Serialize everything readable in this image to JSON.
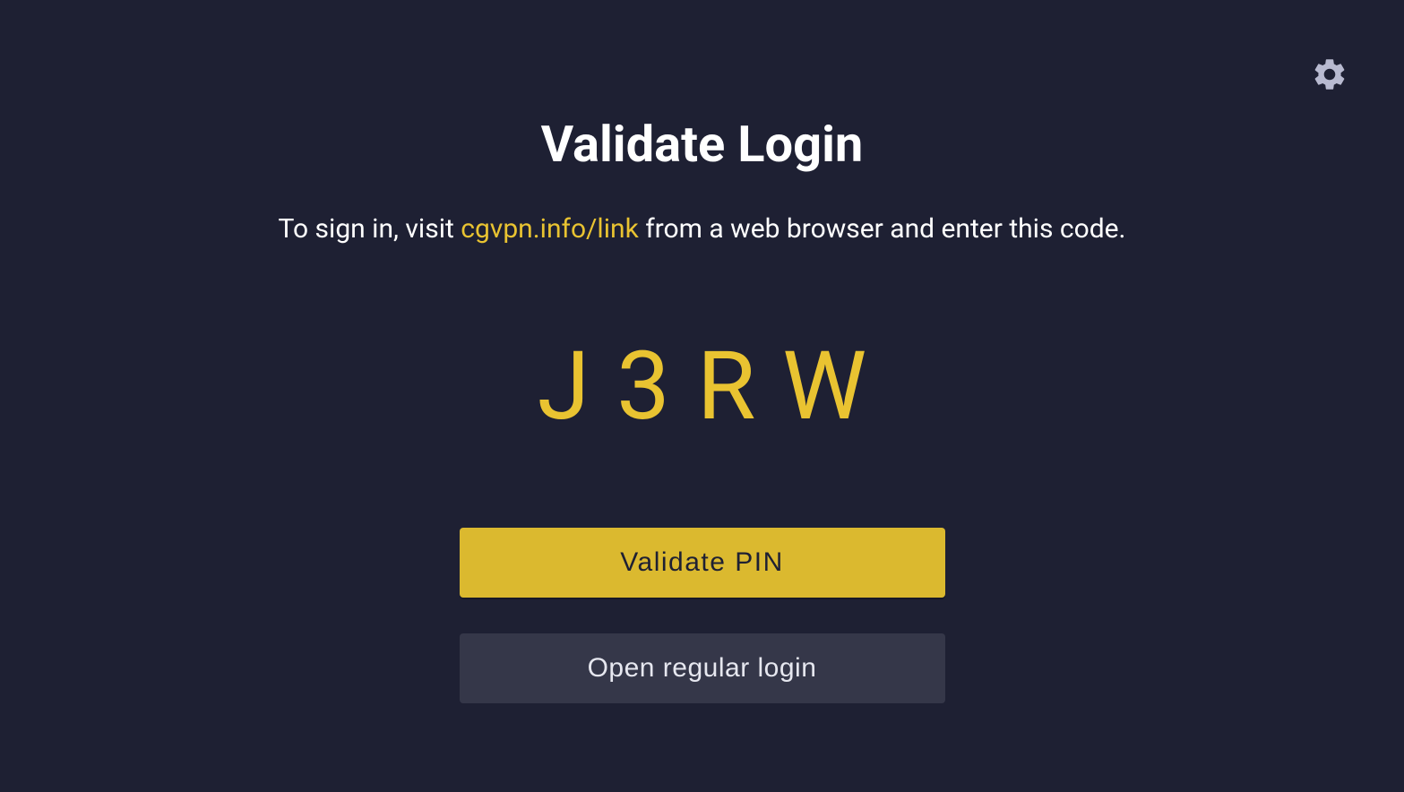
{
  "title": "Validate Login",
  "instruction": {
    "prefix": "To sign in, visit ",
    "link": "cgvpn.info/link",
    "suffix": " from a web browser and enter this code."
  },
  "code": "J3RW",
  "buttons": {
    "validate": "Validate PIN",
    "regular_login": "Open regular login"
  }
}
